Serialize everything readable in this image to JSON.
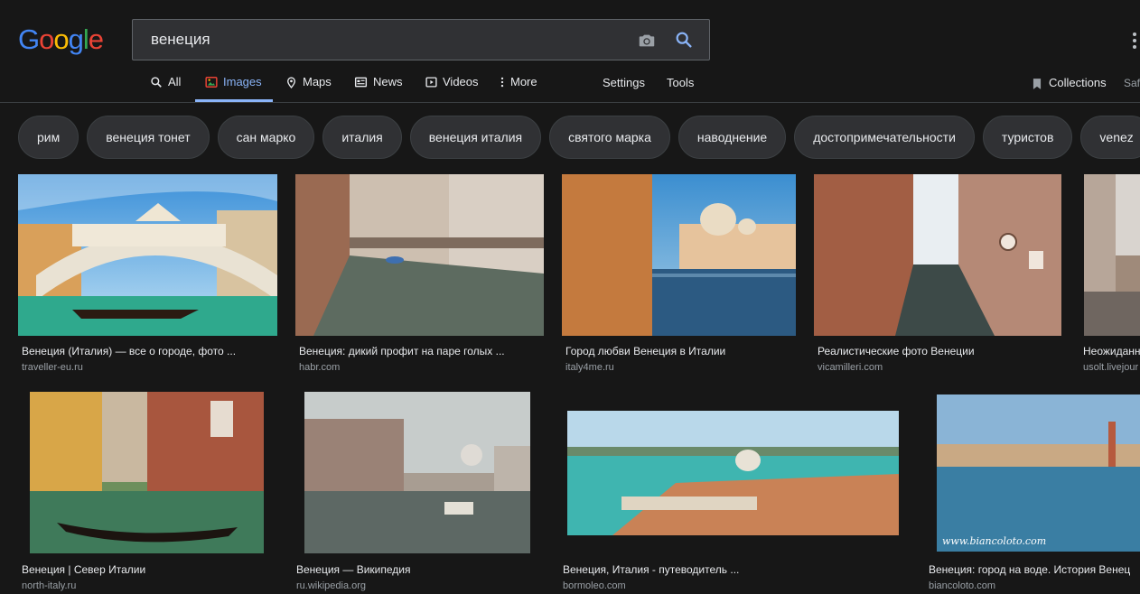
{
  "logo": {
    "letters": [
      "G",
      "o",
      "o",
      "g",
      "l",
      "e"
    ],
    "colors": [
      "#4285f4",
      "#ea4335",
      "#fbbc05",
      "#4285f4",
      "#34a853",
      "#ea4335"
    ]
  },
  "search": {
    "value": "венеция",
    "camera_icon": "camera-icon",
    "search_icon": "search-icon"
  },
  "nav": {
    "tabs": [
      {
        "label": "All",
        "icon": "search-icon"
      },
      {
        "label": "Images",
        "icon": "image-icon",
        "active": true
      },
      {
        "label": "Maps",
        "icon": "map-pin-icon"
      },
      {
        "label": "News",
        "icon": "newspaper-icon"
      },
      {
        "label": "Videos",
        "icon": "play-icon"
      },
      {
        "label": "More",
        "icon": "more-vert-icon"
      }
    ],
    "settings": "Settings",
    "tools": "Tools",
    "collections": "Collections",
    "safesearch": "Saf"
  },
  "chips": [
    "рим",
    "венеция тонет",
    "сан марко",
    "италия",
    "венеция италия",
    "святого марка",
    "наводнение",
    "достопримечательности",
    "туристов",
    "venez"
  ],
  "results": [
    {
      "title": "Венеция (Италия) — все о городе, фото ...",
      "source": "traveller-eu.ru"
    },
    {
      "title": "Венеция: дикий профит на паре голых ...",
      "source": "habr.com"
    },
    {
      "title": "Город любви Венеция в Италии",
      "source": "italy4me.ru"
    },
    {
      "title": "Реалистические фото Венеции",
      "source": "vicamilleri.com"
    },
    {
      "title": "Неожиданн",
      "source": "usolt.livejour"
    },
    {
      "title": "Венеция | Север Италии",
      "source": "north-italy.ru"
    },
    {
      "title": "Венеция — Википедия",
      "source": "ru.wikipedia.org"
    },
    {
      "title": "Венеция, Италия - путеводитель ...",
      "source": "bormoleo.com"
    },
    {
      "title": "Венеция: город на воде. История Венец",
      "source": "biancoloto.com"
    }
  ],
  "watermark": "www.biancoloto.com",
  "colors": {
    "background": "#171717",
    "accent": "#8ab4f8",
    "chip_bg": "#303134"
  }
}
